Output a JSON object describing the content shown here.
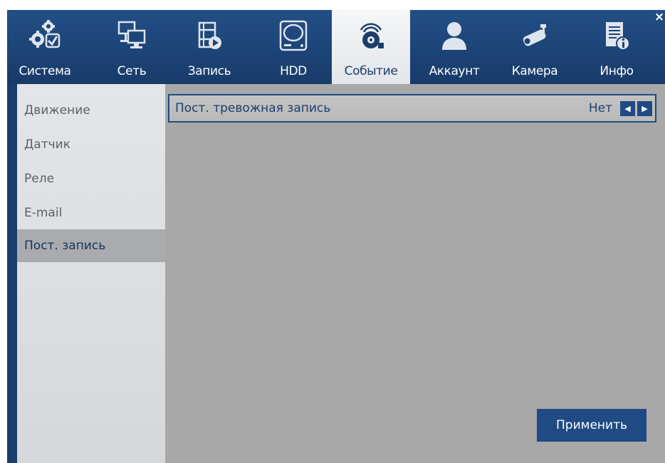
{
  "tabs": [
    {
      "label": "Система",
      "icon": "gears-check-icon"
    },
    {
      "label": "Сеть",
      "icon": "network-monitors-icon"
    },
    {
      "label": "Запись",
      "icon": "film-record-icon"
    },
    {
      "label": "HDD",
      "icon": "hard-drive-icon"
    },
    {
      "label": "Событие",
      "icon": "event-alarm-icon",
      "active": true
    },
    {
      "label": "Аккаунт",
      "icon": "user-account-icon"
    },
    {
      "label": "Камера",
      "icon": "camera-icon"
    },
    {
      "label": "Инфо",
      "icon": "info-document-icon"
    }
  ],
  "close_label": "×",
  "sidebar": {
    "items": [
      {
        "label": "Движение"
      },
      {
        "label": "Датчик"
      },
      {
        "label": "Реле"
      },
      {
        "label": "E-mail"
      },
      {
        "label": "Пост. запись",
        "active": true
      }
    ]
  },
  "setting": {
    "label": "Пост. тревожная запись",
    "value": "Нет",
    "prev": "◀",
    "next": "▶"
  },
  "apply_label": "Применить",
  "colors": {
    "header": "#1c4477",
    "accent": "#1f4a84",
    "content_bg": "#a8a8a8",
    "sidebar_bg": "#dcdee1"
  }
}
